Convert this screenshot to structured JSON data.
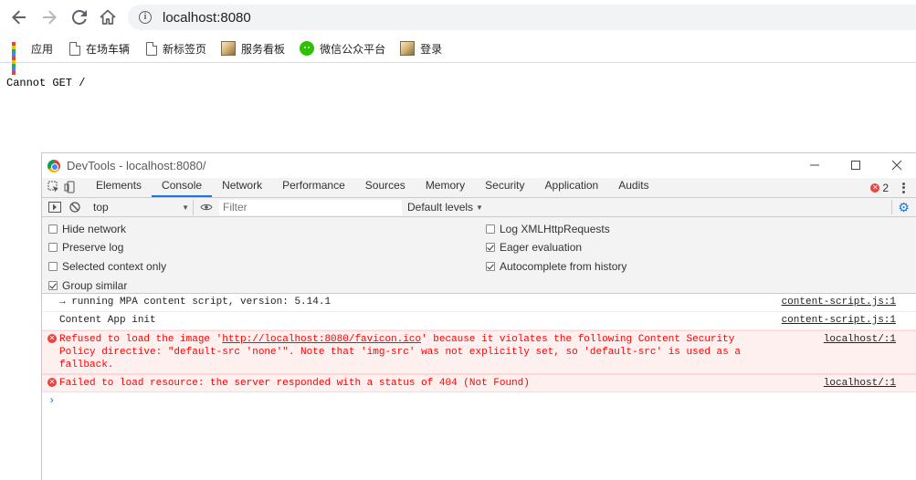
{
  "browser": {
    "url": "localhost:8080",
    "bookmarks": [
      {
        "label": "应用",
        "icon": "apps-grid-icon"
      },
      {
        "label": "在场车辆",
        "icon": "page-icon"
      },
      {
        "label": "新标签页",
        "icon": "page-icon"
      },
      {
        "label": "服务看板",
        "icon": "image-favicon-icon"
      },
      {
        "label": "微信公众平台",
        "icon": "wechat-icon"
      },
      {
        "label": "登录",
        "icon": "image-favicon-icon"
      }
    ]
  },
  "page": {
    "body_text": "Cannot GET /"
  },
  "devtools": {
    "title": "DevTools - localhost:8080/",
    "tabs": [
      "Elements",
      "Console",
      "Network",
      "Performance",
      "Sources",
      "Memory",
      "Security",
      "Application",
      "Audits"
    ],
    "active_tab": "Console",
    "error_count": "2",
    "filter_bar": {
      "context": "top",
      "filter_placeholder": "Filter",
      "levels": "Default levels"
    },
    "settings_left": [
      {
        "label": "Hide network",
        "checked": false
      },
      {
        "label": "Preserve log",
        "checked": false
      },
      {
        "label": "Selected context only",
        "checked": false
      },
      {
        "label": "Group similar",
        "checked": true
      }
    ],
    "settings_right": [
      {
        "label": "Log XMLHttpRequests",
        "checked": false
      },
      {
        "label": "Eager evaluation",
        "checked": true
      },
      {
        "label": "Autocomplete from history",
        "checked": true
      }
    ],
    "messages": [
      {
        "type": "log",
        "text": "→ running MPA content script, version: 5.14.1",
        "source": "content-script.js:1"
      },
      {
        "type": "log",
        "text": "Content App init",
        "source": "content-script.js:1"
      },
      {
        "type": "error",
        "pre": "Refused to load the image '",
        "link": "http://localhost:8080/favicon.ico",
        "post": "' because it violates the following Content Security Policy directive: \"default-src 'none'\". Note that 'img-src' was not explicitly set, so 'default-src' is used as a fallback.",
        "source": "localhost/:1"
      },
      {
        "type": "error",
        "text": "Failed to load resource: the server responded with a status of 404 (Not Found)",
        "source": "localhost/:1"
      }
    ],
    "prompt_symbol": "›"
  },
  "colors": {
    "accent": "#1a73e8",
    "error_red": "#e8453c",
    "error_bg": "#fff0f0",
    "panel_bg": "#f3f3f3"
  }
}
